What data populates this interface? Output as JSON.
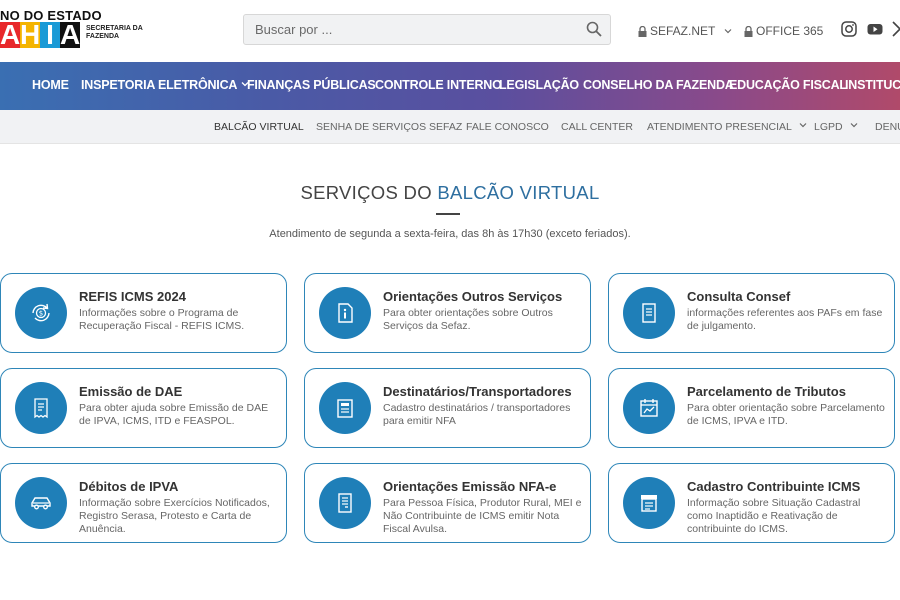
{
  "logo": {
    "top_text": "NO DO ESTADO",
    "big_text": "AHIA",
    "secretaria": "SECRETARIA DA FAZENDA"
  },
  "search": {
    "placeholder": "Buscar por ..."
  },
  "top_links": [
    {
      "label": "SEFAZ.NET"
    },
    {
      "label": "OFFICE 365"
    }
  ],
  "main_nav": [
    {
      "label": "HOME"
    },
    {
      "label": "INSPETORIA ELETRÔNICA"
    },
    {
      "label": "FINANÇAS PÚBLICAS"
    },
    {
      "label": "CONTROLE INTERNO"
    },
    {
      "label": "LEGISLAÇÃO"
    },
    {
      "label": "CONSELHO DA FAZENDA"
    },
    {
      "label": "EDUCAÇÃO FISCAL"
    },
    {
      "label": "INSTITUCIO"
    }
  ],
  "sub_nav": [
    {
      "label": "BALCÃO VIRTUAL"
    },
    {
      "label": "SENHA DE SERVIÇOS SEFAZ"
    },
    {
      "label": "FALE CONOSCO"
    },
    {
      "label": "CALL CENTER"
    },
    {
      "label": "ATENDIMENTO PRESENCIAL"
    },
    {
      "label": "LGPD"
    },
    {
      "label": "DENÚ"
    }
  ],
  "section": {
    "title_prefix": "SERVIÇOS DO ",
    "title_highlight": "BALCÃO VIRTUAL",
    "subtitle": "Atendimento de segunda a sexta-feira, das 8h às 17h30 (exceto feriados)."
  },
  "colors": {
    "accent": "#1f7fb8",
    "card_border": "#2e86b8",
    "title_highlight": "#2e6fa0"
  },
  "cards": [
    {
      "title": "REFIS ICMS 2024",
      "desc": "Informações sobre o Programa de Recuperação Fiscal - REFIS ICMS.",
      "icon": "dollar-refresh-icon"
    },
    {
      "title": "Orientações Outros Serviços",
      "desc": "Para obter orientações sobre Outros Serviços da Sefaz.",
      "icon": "info-document-icon"
    },
    {
      "title": "Consulta Consef",
      "desc": "informações referentes aos PAFs em fase de julgamento.",
      "icon": "document-icon"
    },
    {
      "title": "Emissão de DAE",
      "desc": "Para obter ajuda sobre Emissão de DAE de IPVA, ICMS, ITD e FEASPOL.",
      "icon": "receipt-icon"
    },
    {
      "title": "Destinatários/Transportadores",
      "desc": "Cadastro destinatários / transportadores para emitir NFA",
      "icon": "form-icon"
    },
    {
      "title": "Parcelamento de Tributos",
      "desc": "Para obter orientação sobre Parcelamento de ICMS, IPVA e ITD.",
      "icon": "calendar-chart-icon"
    },
    {
      "title": "Débitos de IPVA",
      "desc": "Informação sobre Exercícios Notificados, Registro Serasa, Protesto e Carta de Anuência.",
      "icon": "car-icon"
    },
    {
      "title": "Orientações Emissão NFA-e",
      "desc": "Para Pessoa Física, Produtor Rural, MEI e Não Contribuinte de ICMS emitir Nota Fiscal Avulsa.",
      "icon": "invoice-icon"
    },
    {
      "title": "Cadastro Contribuinte ICMS",
      "desc": "Informação sobre Situação Cadastral como Inaptidão e Reativação de contribuinte do ICMS.",
      "icon": "store-icon"
    }
  ]
}
